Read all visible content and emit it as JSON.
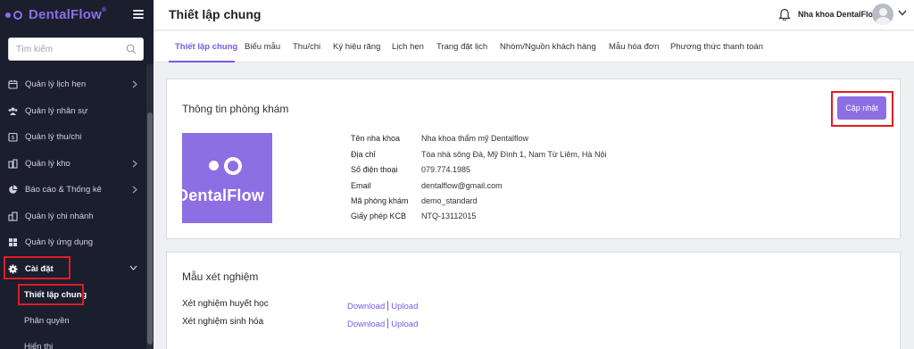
{
  "app": {
    "name": "DentalFlow",
    "reg": "®"
  },
  "colors": {
    "sidebar_bg": "#1b1e2d",
    "accent": "#8d6ee3",
    "highlight_box": "#e11b24"
  },
  "sidebar": {
    "search_placeholder": "Tìm kiếm",
    "items": [
      {
        "label": "Quản lý lịch hẹn",
        "icon": "calendar-icon",
        "has_children": true
      },
      {
        "label": "Quản lý nhân sự",
        "icon": "users-icon",
        "has_children": false
      },
      {
        "label": "Quản lý thu/chi",
        "icon": "wallet-icon",
        "has_children": false
      },
      {
        "label": "Quản lý kho",
        "icon": "warehouse-icon",
        "has_children": true
      },
      {
        "label": "Báo cáo & Thống kê",
        "icon": "pie-chart-icon",
        "has_children": true
      },
      {
        "label": "Quản lý chi nhánh",
        "icon": "branch-icon",
        "has_children": false
      },
      {
        "label": "Quản lý ứng dụng",
        "icon": "apps-icon",
        "has_children": false
      },
      {
        "label": "Cài đặt",
        "icon": "gear-icon",
        "has_children": true,
        "expanded": true
      }
    ],
    "sub_items": [
      {
        "label": "Thiết lập chung",
        "active": true
      },
      {
        "label": "Phân quyền",
        "active": false
      },
      {
        "label": "Hiển thị",
        "active": false
      }
    ]
  },
  "header": {
    "title": "Thiết lập chung",
    "clinic_name": "Nha khoa DentalFlow"
  },
  "tabs": [
    "Thiết lập chung",
    "Biểu mẫu",
    "Thu/chi",
    "Ký hiệu răng",
    "Lịch hẹn",
    "Trang đặt lịch",
    "Nhóm/Nguồn khách hàng",
    "Mẫu hóa đơn",
    "Phương thức thanh toán"
  ],
  "clinic_info": {
    "title": "Thông tin phòng khám",
    "update_button": "Cập nhật",
    "logo_text": "DentalFlow",
    "fields": [
      {
        "label": "Tên nha khoa",
        "value": "Nha khoa thẩm mỹ Dentalflow"
      },
      {
        "label": "Địa chỉ",
        "value": "Tòa nhà sông Đà, Mỹ Đình 1, Nam Từ Liêm, Hà Nội"
      },
      {
        "label": "Số điện thoại",
        "value": "079.774.1985"
      },
      {
        "label": "Email",
        "value": "dentalflow@gmail.com"
      },
      {
        "label": "Mã phòng khám",
        "value": "demo_standard"
      },
      {
        "label": "Giấy phép KCB",
        "value": "NTQ-13112015"
      }
    ]
  },
  "test_templates": {
    "title": "Mẫu xét nghiệm",
    "download_label": "Download",
    "upload_label": "Upload",
    "rows": [
      {
        "label": "Xét nghiệm huyết học"
      },
      {
        "label": "Xét nghiệm sinh hóa"
      }
    ]
  }
}
